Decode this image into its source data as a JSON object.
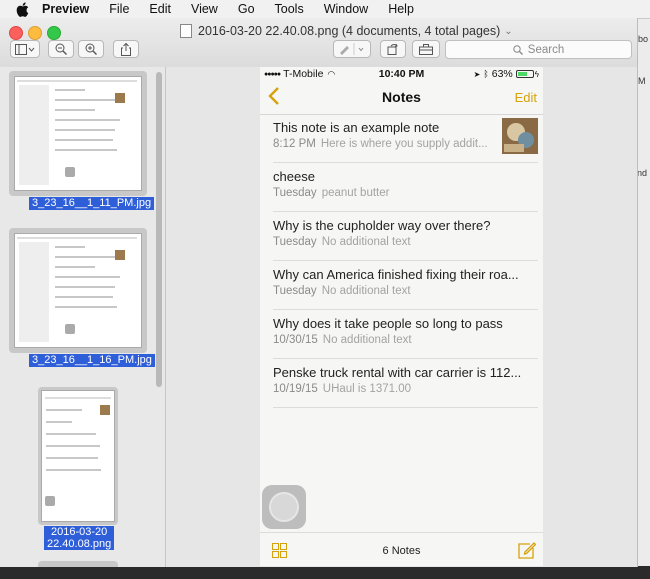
{
  "menubar": {
    "app_name": "Preview",
    "items": [
      "File",
      "Edit",
      "View",
      "Go",
      "Tools",
      "Window",
      "Help"
    ]
  },
  "window": {
    "title": "2016-03-20 22.40.08.png (4 documents, 4 total pages)"
  },
  "toolbar": {
    "search_placeholder": "Search"
  },
  "sidebar": {
    "thumbnails": [
      {
        "label": "3_23_16__1_11_PM.jpg",
        "selected": true
      },
      {
        "label": "3_23_16__1_16_PM.jpg",
        "selected": true
      },
      {
        "label": "2016-03-20 22.40.08.png",
        "label_line1": "2016-03-20",
        "label_line2": "22.40.08.png",
        "selected": true
      }
    ]
  },
  "phone": {
    "carrier": "T-Mobile",
    "time": "10:40 PM",
    "battery": "63%",
    "battery_level": 0.63,
    "nav_title": "Notes",
    "edit_label": "Edit",
    "notes": [
      {
        "title": "This note is an example note",
        "date": "8:12 PM",
        "preview": "Here is where you supply addit..."
      },
      {
        "title": "cheese",
        "date": "Tuesday",
        "preview": "peanut butter"
      },
      {
        "title": "Why is the cupholder way over there?",
        "date": "Tuesday",
        "preview": "No additional text"
      },
      {
        "title": "Why can America finished fixing their roa...",
        "date": "Tuesday",
        "preview": "No additional text"
      },
      {
        "title": "Why does it take people so long to pass",
        "date": "10/30/15",
        "preview": "No additional text"
      },
      {
        "title": "Penske truck rental with car carrier is 112...",
        "date": "10/19/15",
        "preview": "UHaul is 1371.00"
      }
    ],
    "notes_count": "6 Notes"
  },
  "colors": {
    "accent_yellow": "#d6a20c",
    "selection_blue": "#2f5fd8"
  }
}
